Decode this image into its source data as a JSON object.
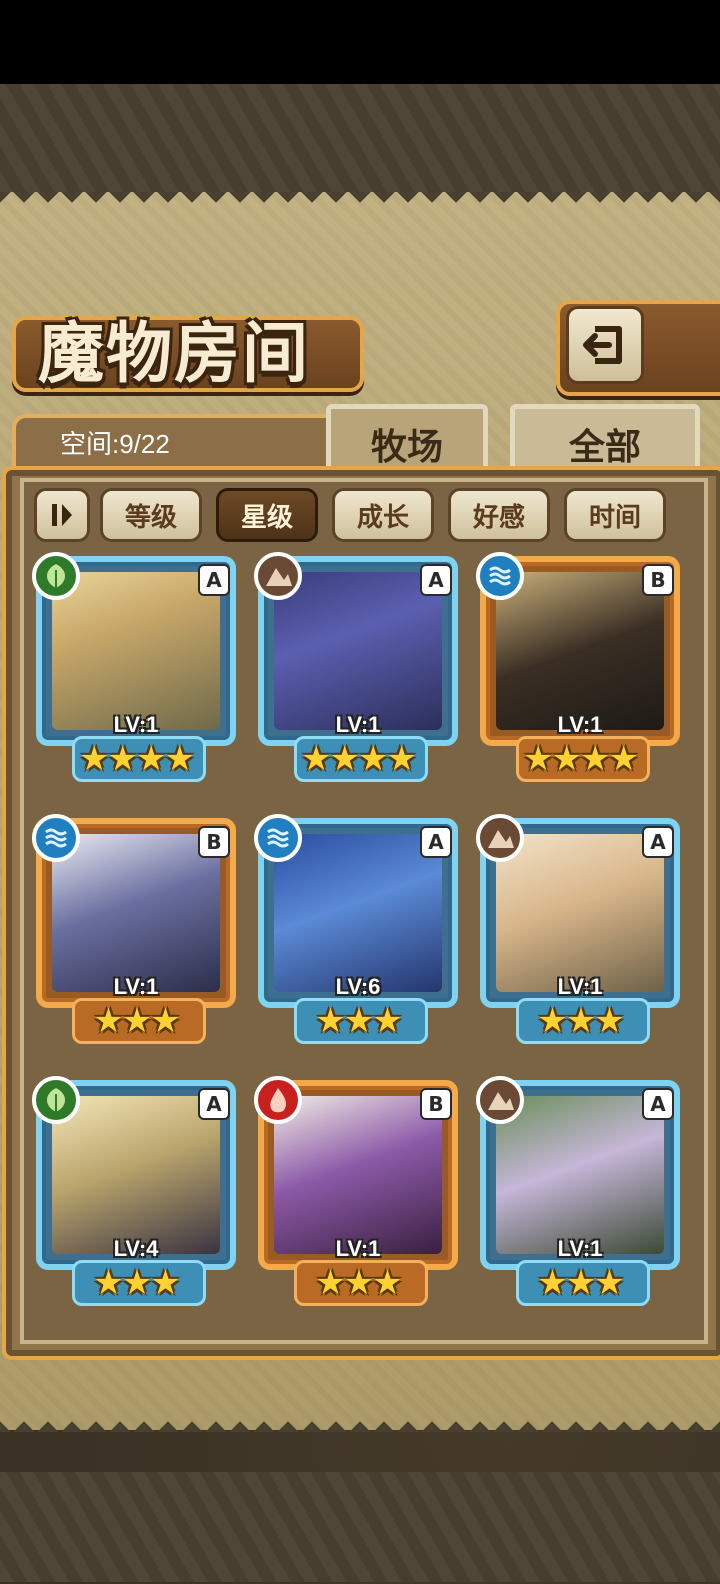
{
  "header": {
    "title": "魔物房间",
    "back_icon": "return-arrow-icon"
  },
  "storage": {
    "label": "空间:9/22"
  },
  "tabs": [
    {
      "label": "牧场"
    },
    {
      "label": "全部"
    }
  ],
  "filters": {
    "sort_icon": "sort-toggle-icon",
    "items": [
      {
        "label": "等级",
        "active": false
      },
      {
        "label": "星级",
        "active": true
      },
      {
        "label": "成长",
        "active": false
      },
      {
        "label": "好感",
        "active": false
      },
      {
        "label": "时间",
        "active": false
      }
    ]
  },
  "monsters": [
    {
      "element": "wood",
      "rank": "A",
      "level": "LV:1",
      "stars": 4,
      "frame": "blue"
    },
    {
      "element": "earth",
      "rank": "A",
      "level": "LV:1",
      "stars": 4,
      "frame": "blue"
    },
    {
      "element": "water",
      "rank": "B",
      "level": "LV:1",
      "stars": 4,
      "frame": "orange"
    },
    {
      "element": "water",
      "rank": "B",
      "level": "LV:1",
      "stars": 3,
      "frame": "orange"
    },
    {
      "element": "water",
      "rank": "A",
      "level": "LV:6",
      "stars": 3,
      "frame": "blue"
    },
    {
      "element": "earth",
      "rank": "A",
      "level": "LV:1",
      "stars": 3,
      "frame": "blue"
    },
    {
      "element": "wood",
      "rank": "A",
      "level": "LV:4",
      "stars": 3,
      "frame": "blue"
    },
    {
      "element": "fire",
      "rank": "B",
      "level": "LV:1",
      "stars": 3,
      "frame": "orange"
    },
    {
      "element": "earth",
      "rank": "A",
      "level": "LV:1",
      "stars": 3,
      "frame": "blue"
    }
  ],
  "colors": {
    "wood": "#2f7a28",
    "earth": "#6b4a35",
    "water": "#1f7fc0",
    "fire": "#c8201e"
  }
}
